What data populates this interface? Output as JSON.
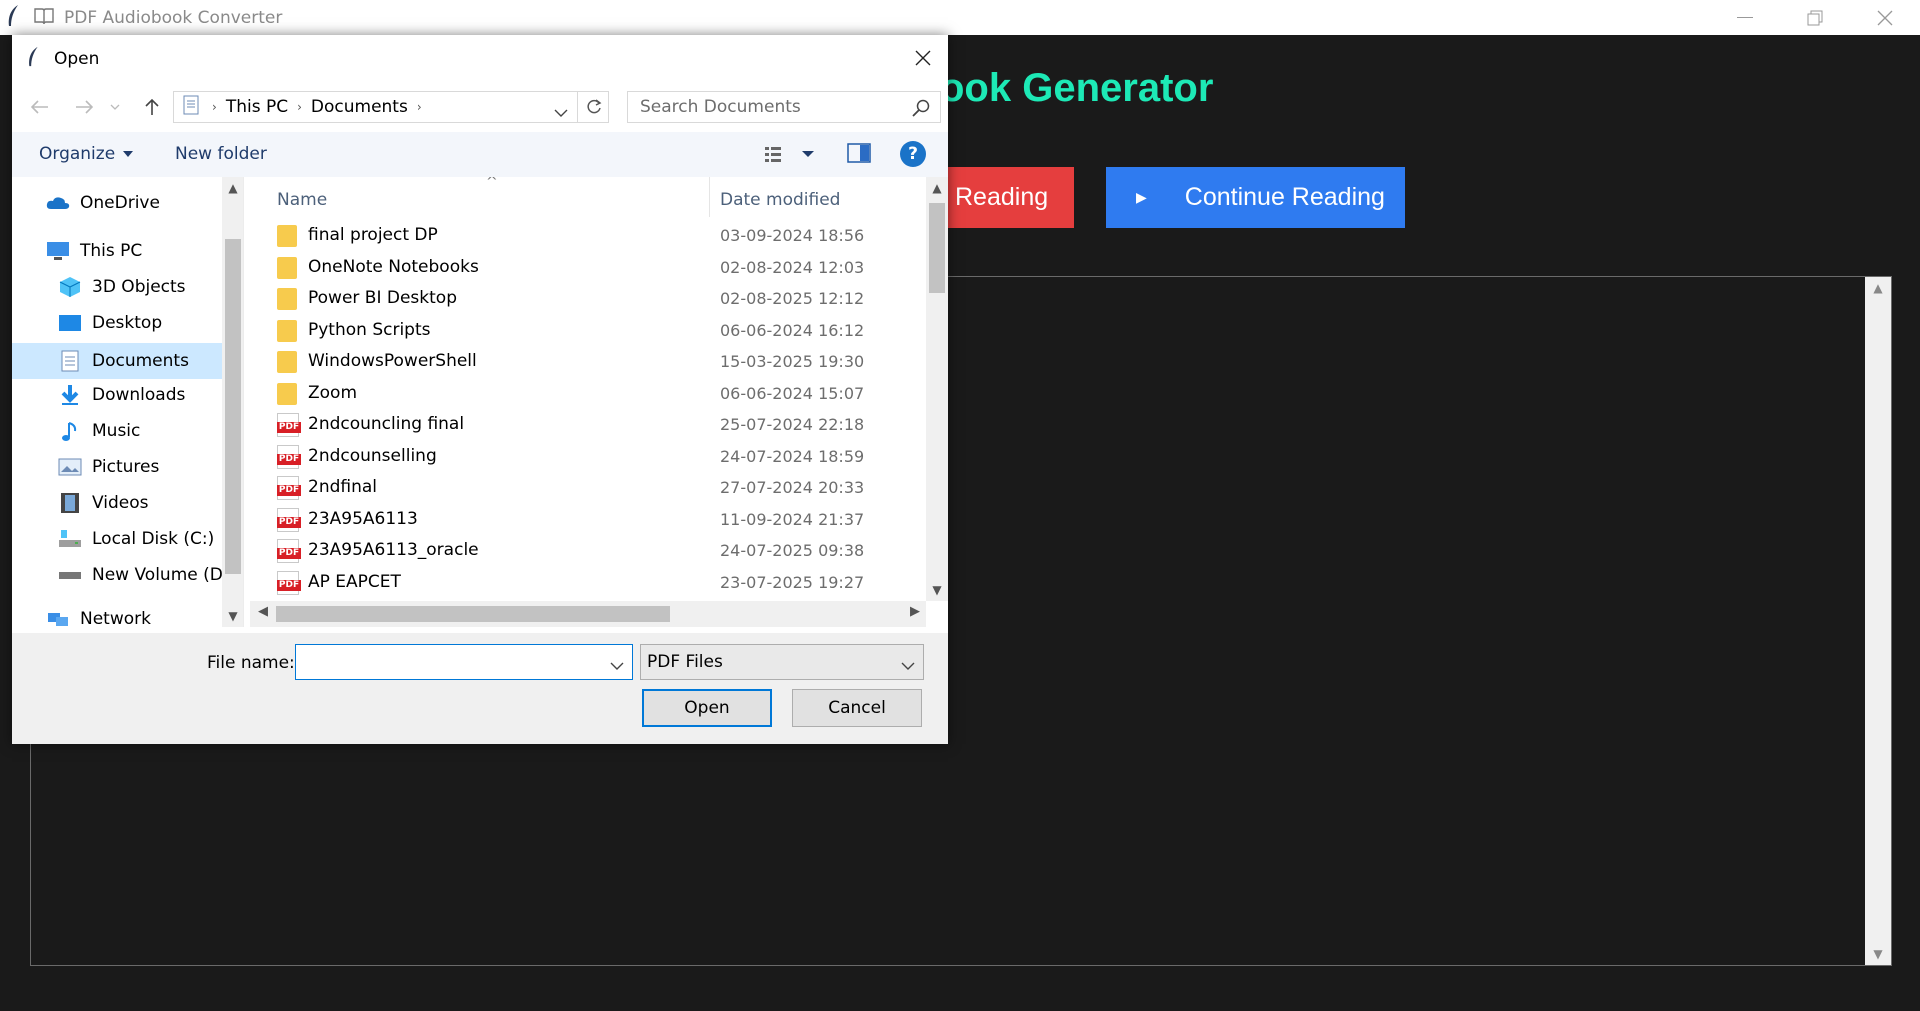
{
  "app": {
    "title": "PDF Audiobook Converter",
    "heading": "ook Generator",
    "buttons": {
      "start_reading": "Reading",
      "continue_reading": "Continue Reading"
    },
    "colors": {
      "background": "#1a1a1a",
      "heading": "#1de9b6",
      "start_button": "#e53e3e",
      "continue_button": "#2f7bf0"
    }
  },
  "dialog": {
    "title": "Open",
    "breadcrumb": [
      "This PC",
      "Documents"
    ],
    "search_placeholder": "Search Documents",
    "toolbar": {
      "organize": "Organize",
      "new_folder": "New folder"
    },
    "nav_items": [
      {
        "label": "OneDrive",
        "icon": "cloud-icon"
      },
      {
        "label": "This PC",
        "icon": "computer-icon"
      },
      {
        "label": "3D Objects",
        "icon": "cube-icon"
      },
      {
        "label": "Desktop",
        "icon": "desktop-icon"
      },
      {
        "label": "Documents",
        "icon": "documents-icon",
        "selected": true
      },
      {
        "label": "Downloads",
        "icon": "download-icon"
      },
      {
        "label": "Music",
        "icon": "music-icon"
      },
      {
        "label": "Pictures",
        "icon": "pictures-icon"
      },
      {
        "label": "Videos",
        "icon": "videos-icon"
      },
      {
        "label": "Local Disk (C:)",
        "icon": "disk-icon"
      },
      {
        "label": "New Volume (D:",
        "icon": "drive-icon"
      },
      {
        "label": "Network",
        "icon": "network-icon"
      }
    ],
    "columns": {
      "name": "Name",
      "date_modified": "Date modified"
    },
    "files": [
      {
        "name": "final project DP",
        "date": "03-09-2024 18:56",
        "type": "folder"
      },
      {
        "name": "OneNote Notebooks",
        "date": "02-08-2024 12:03",
        "type": "folder"
      },
      {
        "name": "Power BI Desktop",
        "date": "02-08-2025 12:12",
        "type": "folder"
      },
      {
        "name": "Python Scripts",
        "date": "06-06-2024 16:12",
        "type": "folder"
      },
      {
        "name": "WindowsPowerShell",
        "date": "15-03-2025 19:30",
        "type": "folder"
      },
      {
        "name": "Zoom",
        "date": "06-06-2024 15:07",
        "type": "folder"
      },
      {
        "name": "2ndcouncling final",
        "date": "25-07-2024 22:18",
        "type": "pdf"
      },
      {
        "name": "2ndcounselling",
        "date": "24-07-2024 18:59",
        "type": "pdf"
      },
      {
        "name": "2ndfinal",
        "date": "27-07-2024 20:33",
        "type": "pdf"
      },
      {
        "name": "23A95A6113",
        "date": "11-09-2024 21:37",
        "type": "pdf"
      },
      {
        "name": "23A95A6113_oracle",
        "date": "24-07-2025 09:38",
        "type": "pdf"
      },
      {
        "name": "AP EAPCET",
        "date": "23-07-2025 19:27",
        "type": "pdf"
      }
    ],
    "file_name_label": "File name:",
    "file_name_value": "",
    "file_type": "PDF Files",
    "open_button": "Open",
    "cancel_button": "Cancel",
    "pdf_badge": "PDF",
    "help_label": "?"
  }
}
